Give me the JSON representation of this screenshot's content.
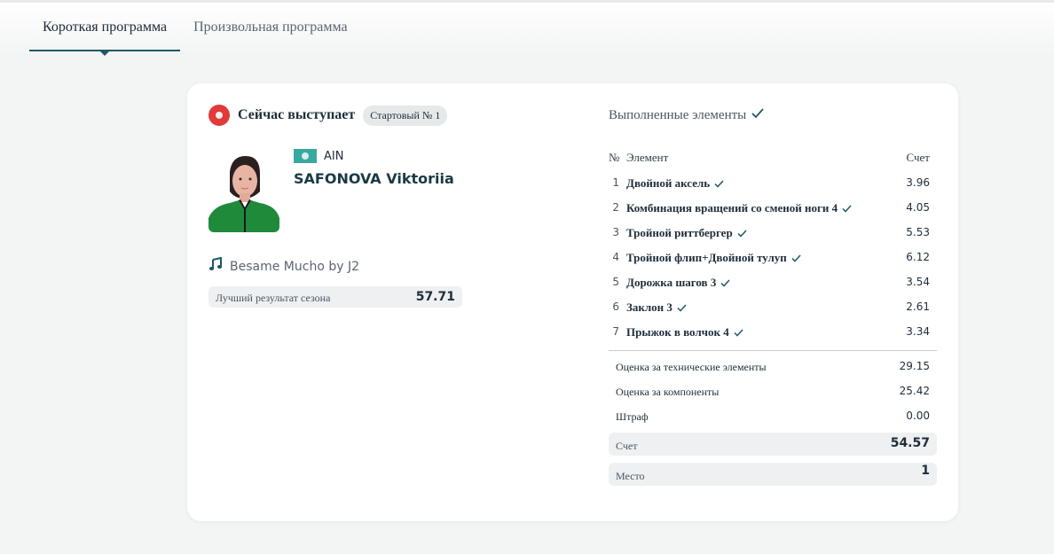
{
  "tabs": [
    {
      "label": "Короткая программа",
      "active": true
    },
    {
      "label": "Произвольная программа",
      "active": false
    }
  ],
  "now_performing": {
    "title": "Сейчас выступает",
    "start_badge": "Стартовый № 1",
    "status_color": "#e03a3a"
  },
  "athlete": {
    "country": "AIN",
    "name": "SAFONOVA Viktoriia"
  },
  "music": {
    "icon": "music-note-icon",
    "title": "Besame Mucho by J2"
  },
  "season_best": {
    "label": "Лучший результат сезона",
    "value": "57.71"
  },
  "elements": {
    "title": "Выполненные элементы",
    "headers": {
      "no": "№",
      "element": "Элемент",
      "score": "Счет"
    },
    "rows": [
      {
        "no": "1",
        "name": "Двойной аксель",
        "score": "3.96"
      },
      {
        "no": "2",
        "name": "Комбинация вращений со сменой ноги 4",
        "score": "4.05"
      },
      {
        "no": "3",
        "name": "Тройной риттбергер",
        "score": "5.53"
      },
      {
        "no": "4",
        "name": "Тройной флип+Двойной тулуп",
        "score": "6.12"
      },
      {
        "no": "5",
        "name": "Дорожка шагов 3",
        "score": "3.54"
      },
      {
        "no": "6",
        "name": "Заклон 3",
        "score": "2.61"
      },
      {
        "no": "7",
        "name": "Прыжок в волчок 4",
        "score": "3.34"
      }
    ]
  },
  "summary": {
    "technical": {
      "label": "Оценка за технические элементы",
      "value": "29.15"
    },
    "components": {
      "label": "Оценка за компоненты",
      "value": "25.42"
    },
    "penalty": {
      "label": "Штраф",
      "value": "0.00"
    },
    "total": {
      "label": "Счет",
      "value": "54.57"
    },
    "place": {
      "label": "Место",
      "value": "1"
    }
  },
  "colors": {
    "accent": "#1d5866",
    "live": "#e03a3a",
    "flag": "#3aa8a0",
    "panel_bg": "#eef0f1"
  }
}
